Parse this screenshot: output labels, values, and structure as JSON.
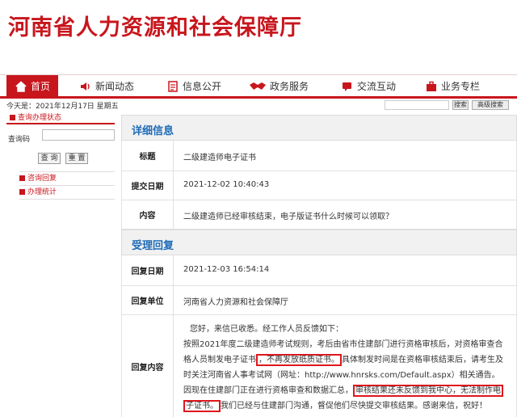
{
  "site_title": "河南省人力资源和社会保障厅",
  "nav": {
    "items": [
      {
        "label": "首页",
        "icon": "home-icon"
      },
      {
        "label": "新闻动态",
        "icon": "speaker-icon"
      },
      {
        "label": "信息公开",
        "icon": "document-icon"
      },
      {
        "label": "政务服务",
        "icon": "handshake-icon"
      },
      {
        "label": "交流互动",
        "icon": "chat-icon"
      },
      {
        "label": "业务专栏",
        "icon": "briefcase-icon"
      }
    ]
  },
  "subbar": {
    "today": "今天是：2021年12月17日  星期五",
    "search_label": "搜索",
    "advanced_label": "高级搜索"
  },
  "sidebar": {
    "head": "查询办理状态",
    "query_label": "查询码",
    "query_btn": "查 询",
    "reset_btn": "重 置",
    "items": [
      "咨询回复",
      "办理统计"
    ]
  },
  "detail": {
    "title": "详细信息",
    "rows": [
      {
        "label": "标题",
        "value": "二级建造师电子证书"
      },
      {
        "label": "提交日期",
        "value": "2021-12-02 10:40:43"
      },
      {
        "label": "内容",
        "value": "二级建造师已经审核结束，电子版证书什么时候可以领取？"
      }
    ]
  },
  "reply": {
    "title": "受理回复",
    "date_label": "回复日期",
    "date_value": "2021-12-03 16:54:14",
    "unit_label": "回复单位",
    "unit_value": "河南省人力资源和社会保障厅",
    "content_label": "回复内容",
    "p1": "您好，来信已收悉。经工作人员反馈如下：",
    "p2a": "按照2021年度二级建造师考试规则，考后由省市住建部门进行资格审核后，对资格审查合",
    "p2b": "格人员制发电子证书",
    "p2c": "，不再发放纸质证书。",
    "p2d": "具体制发时间是在资格审核结束后，请考生及",
    "p2e": "时关注河南省人事考试网（网址：http://www.hnrsks.com/Default.aspx）相关通告。",
    "p3a": "因现在住建部门正在进行资格审查和数据汇总，",
    "p3b": "审核结果还未反馈到我中心，无法制作电",
    "p3c": "子证书。",
    "p3d": "我们已经与住建部门沟通，督促他们尽快提交审核结果。感谢来信，祝好！"
  }
}
